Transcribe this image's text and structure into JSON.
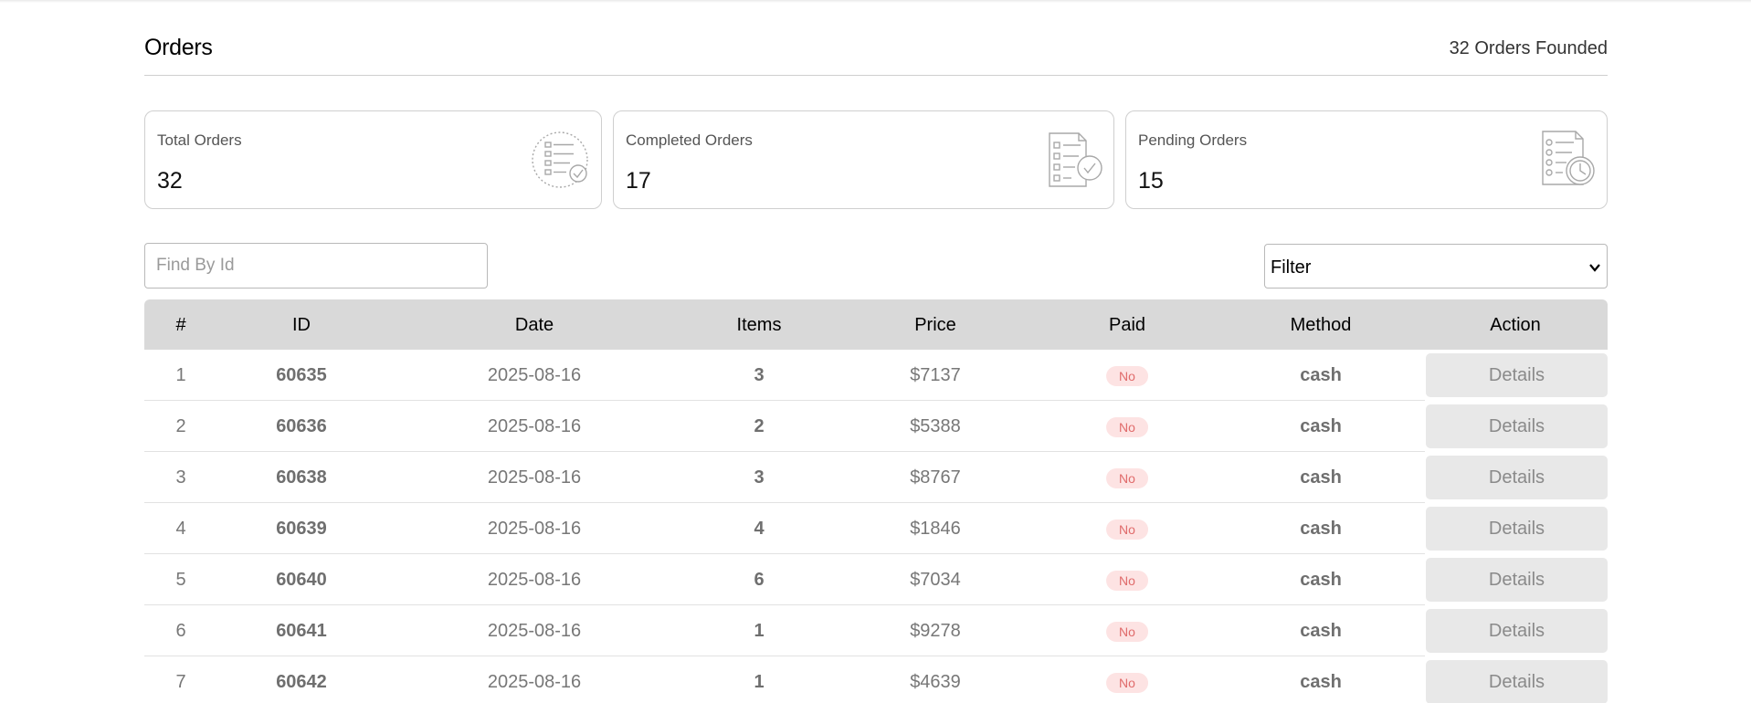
{
  "header": {
    "title": "Orders",
    "found_text": "32 Orders Founded"
  },
  "cards": [
    {
      "label": "Total Orders",
      "value": "32",
      "icon": "list-check-circle-icon"
    },
    {
      "label": "Completed Orders",
      "value": "17",
      "icon": "document-check-icon"
    },
    {
      "label": "Pending Orders",
      "value": "15",
      "icon": "document-clock-icon"
    }
  ],
  "search": {
    "placeholder": "Find By Id",
    "value": ""
  },
  "filter": {
    "selected": "Filter"
  },
  "table": {
    "headers": [
      "#",
      "ID",
      "Date",
      "Items",
      "Price",
      "Paid",
      "Method",
      "Action"
    ],
    "rows": [
      {
        "n": "1",
        "id": "60635",
        "date": "2025-08-16",
        "items": "3",
        "price": "$7137",
        "paid": "No",
        "method": "cash",
        "action": "Details"
      },
      {
        "n": "2",
        "id": "60636",
        "date": "2025-08-16",
        "items": "2",
        "price": "$5388",
        "paid": "No",
        "method": "cash",
        "action": "Details"
      },
      {
        "n": "3",
        "id": "60638",
        "date": "2025-08-16",
        "items": "3",
        "price": "$8767",
        "paid": "No",
        "method": "cash",
        "action": "Details"
      },
      {
        "n": "4",
        "id": "60639",
        "date": "2025-08-16",
        "items": "4",
        "price": "$1846",
        "paid": "No",
        "method": "cash",
        "action": "Details"
      },
      {
        "n": "5",
        "id": "60640",
        "date": "2025-08-16",
        "items": "6",
        "price": "$7034",
        "paid": "No",
        "method": "cash",
        "action": "Details"
      },
      {
        "n": "6",
        "id": "60641",
        "date": "2025-08-16",
        "items": "1",
        "price": "$9278",
        "paid": "No",
        "method": "cash",
        "action": "Details"
      },
      {
        "n": "7",
        "id": "60642",
        "date": "2025-08-16",
        "items": "1",
        "price": "$4639",
        "paid": "No",
        "method": "cash",
        "action": "Details"
      }
    ]
  },
  "colors": {
    "header_bg": "#d9d9d9",
    "paid_no_bg": "#fde3e3",
    "paid_no_text": "#e06b6b",
    "button_bg": "#e8e8e8"
  }
}
